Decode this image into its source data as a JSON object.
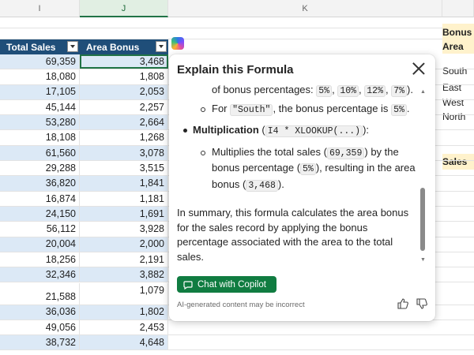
{
  "spreadsheet": {
    "column_headers": [
      "I",
      "J",
      "K"
    ],
    "table_headers": {
      "total_sales": "Total Sales",
      "area_bonus": "Area Bonus"
    },
    "rows": [
      {
        "sales": "69,359",
        "bonus": "3,468"
      },
      {
        "sales": "18,080",
        "bonus": "1,808"
      },
      {
        "sales": "17,105",
        "bonus": "2,053"
      },
      {
        "sales": "45,144",
        "bonus": "2,257"
      },
      {
        "sales": "53,280",
        "bonus": "2,664"
      },
      {
        "sales": "18,108",
        "bonus": "1,268"
      },
      {
        "sales": "61,560",
        "bonus": "3,078"
      },
      {
        "sales": "29,288",
        "bonus": "3,515"
      },
      {
        "sales": "36,820",
        "bonus": "1,841"
      },
      {
        "sales": "16,874",
        "bonus": "1,181"
      },
      {
        "sales": "24,150",
        "bonus": "1,691"
      },
      {
        "sales": "56,112",
        "bonus": "3,928"
      },
      {
        "sales": "20,004",
        "bonus": "2,000"
      },
      {
        "sales": "18,256",
        "bonus": "2,191"
      },
      {
        "sales": "32,346",
        "bonus": "3,882"
      },
      {
        "sales": "21,588",
        "bonus": "1,079"
      },
      {
        "sales": "36,036",
        "bonus": "1,802"
      },
      {
        "sales": "49,056",
        "bonus": "2,453"
      },
      {
        "sales": "38,732",
        "bonus": "4,648"
      }
    ],
    "right_column": {
      "header_line1": "Bonus",
      "header_line2": "Area",
      "areas": [
        "South",
        "East",
        "West",
        "North"
      ],
      "sales_label": "Sales"
    }
  },
  "panel": {
    "title": "Explain this Formula",
    "list_line1_text": "of bonus percentages:",
    "percentages": [
      "5%",
      "10%",
      "12%",
      "7%"
    ],
    "south_prefix": "For",
    "south_code": "\"South\"",
    "south_mid": ", the bonus percentage is",
    "south_pct": "5%",
    "multiplication_label": "Multiplication",
    "multiplication_code": "I4 * XLOOKUP(...)",
    "mult_text1": "Multiplies the total sales (",
    "mult_sales": "69,359",
    "mult_text2": ") by the",
    "mult_text3": "bonus percentage (",
    "mult_pct": "5%",
    "mult_text4": "), resulting in the",
    "mult_text5": "area bonus (",
    "mult_bonus": "3,468",
    "mult_text6": ").",
    "summary": "In summary, this formula calculates the area bonus for the sales record by applying the bonus percentage associated with the area to the total sales.",
    "chat_button": "Chat with Copilot",
    "disclaimer": "AI-generated content may be incorrect"
  },
  "colors": {
    "accent_green": "#107c41",
    "table_header": "#1f4e79",
    "band": "#dce9f6"
  },
  "icons": [
    "close-icon",
    "chat-icon",
    "thumbs-up-icon",
    "thumbs-down-icon",
    "copilot-icon",
    "filter-icon"
  ]
}
